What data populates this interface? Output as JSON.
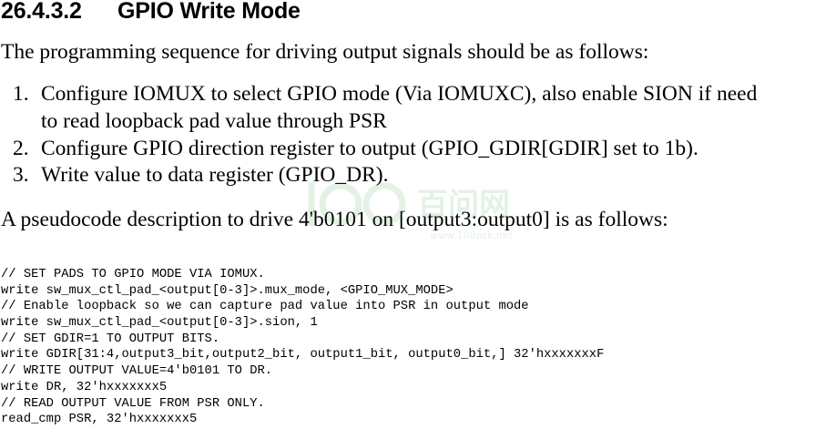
{
  "section": {
    "number": "26.4.3.2",
    "title": "GPIO Write Mode"
  },
  "intro": "The programming sequence for driving output signals should be as follows:",
  "steps": [
    {
      "num": "1.",
      "line1": "Configure IOMUX to select GPIO mode (Via IOMUXC), also enable SION if need",
      "line2": "to read loopback pad value through PSR"
    },
    {
      "num": "2.",
      "line1": "Configure GPIO direction register to output (GPIO_GDIR[GDIR] set to 1b)."
    },
    {
      "num": "3.",
      "line1": "Write value to data register (GPIO_DR)."
    }
  ],
  "pseudo_intro": "A pseudocode description to drive 4'b0101 on [output3:output0] is as follows:",
  "code_lines": [
    "// SET PADS TO GPIO MODE VIA IOMUX.",
    "write sw_mux_ctl_pad_<output[0-3]>.mux_mode, <GPIO_MUX_MODE>",
    "// Enable loopback so we can capture pad value into PSR in output mode",
    "write sw_mux_ctl_pad_<output[0-3]>.sion, 1",
    "// SET GDIR=1 TO OUTPUT BITS.",
    "write GDIR[31:4,output3_bit,output2_bit, output1_bit, output0_bit,] 32'hxxxxxxxF",
    "// WRITE OUTPUT VALUE=4'b0101 TO DR.",
    "write DR, 32'hxxxxxxx5",
    "// READ OUTPUT VALUE FROM PSR ONLY.",
    "read_cmp PSR, 32'hxxxxxxx5"
  ],
  "watermark": {
    "text": "百问网",
    "url": "www.100ask.net",
    "color": "#2e9e3a"
  }
}
